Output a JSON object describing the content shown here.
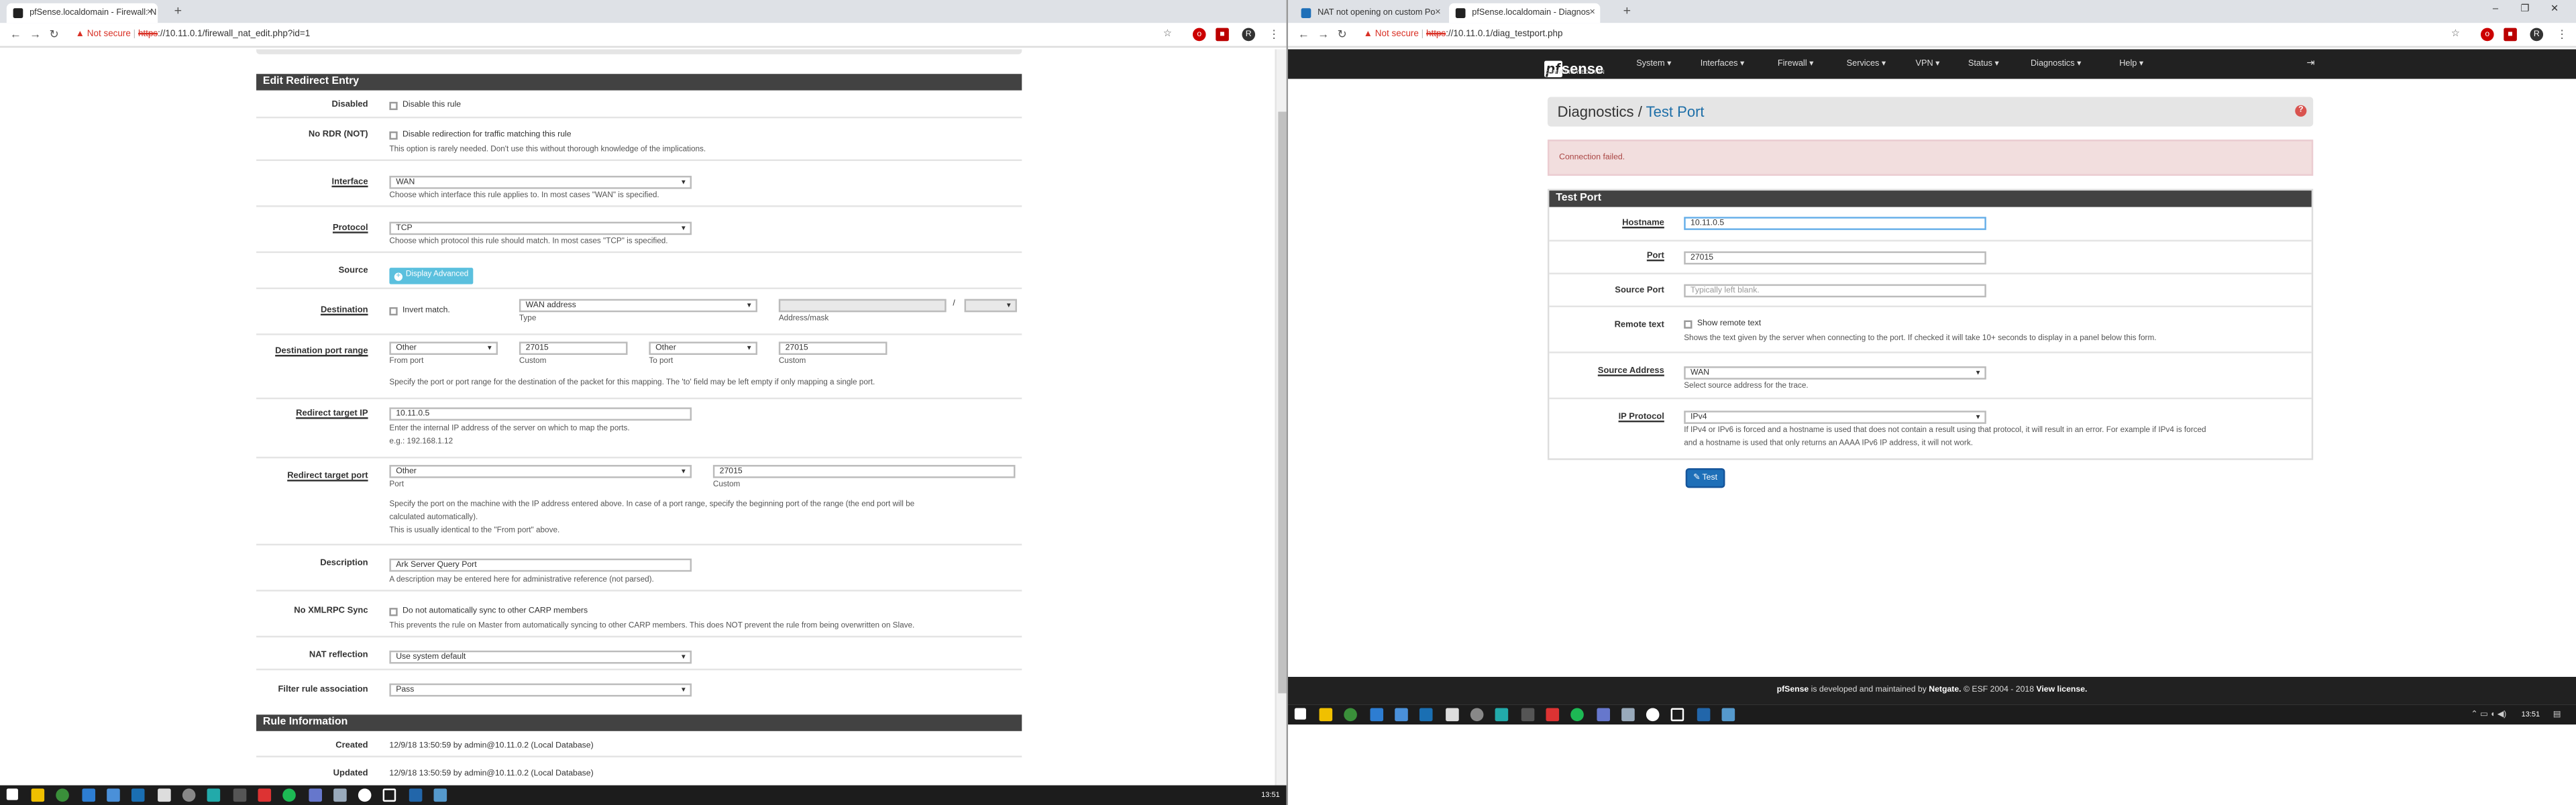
{
  "colors": {
    "pf_dark": "#212121",
    "panel_head": "#424242",
    "accent_blue": "#1e6fb8",
    "alert_bg": "#f2dede",
    "info_btn": "#5bc0de",
    "taskbar": "#1c1c1c"
  },
  "left": {
    "tabs": [
      {
        "title": "pfSense.localdomain - Firewall: N",
        "close": "×"
      }
    ],
    "new_tab": "+",
    "address": {
      "warning": "Not secure",
      "scheme": "https",
      "url_rest": "://10.11.0.1/firewall_nat_edit.php?id=1"
    },
    "panel_title": "Edit Redirect Entry",
    "disabled": {
      "label": "Disabled",
      "text": "Disable this rule"
    },
    "nordr": {
      "label": "No RDR (NOT)",
      "text": "Disable redirection for traffic matching this rule",
      "help": "This option is rarely needed. Don't use this without thorough knowledge of the implications."
    },
    "interface": {
      "label": "Interface",
      "value": "WAN",
      "help": "Choose which interface this rule applies to. In most cases \"WAN\" is specified."
    },
    "protocol": {
      "label": "Protocol",
      "value": "TCP",
      "help": "Choose which protocol this rule should match. In most cases \"TCP\" is specified."
    },
    "source": {
      "label": "Source",
      "button": "Display Advanced"
    },
    "destination": {
      "label": "Destination",
      "invert": "Invert match.",
      "type_value": "WAN address",
      "type_label": "Type",
      "addr_label": "Address/mask",
      "slash": "/"
    },
    "dport": {
      "label": "Destination port range",
      "from_sel": "Other",
      "from_val": "27015",
      "to_sel": "Other",
      "to_val": "27015",
      "from_label": "From port",
      "custom1": "Custom",
      "to_label": "To port",
      "custom2": "Custom",
      "help": "Specify the port or port range for the destination of the packet for this mapping. The 'to' field may be left empty if only mapping a single port."
    },
    "redirect_ip": {
      "label": "Redirect target IP",
      "value": "10.11.0.5",
      "help1": "Enter the internal IP address of the server on which to map the ports.",
      "help2": "e.g.: 192.168.1.12"
    },
    "redirect_port": {
      "label": "Redirect target port",
      "sel": "Other",
      "value": "27015",
      "port_label": "Port",
      "custom": "Custom",
      "help1": "Specify the port on the machine with the IP address entered above. In case of a port range, specify the beginning port of the range (the end port will be",
      "help2": "calculated automatically).",
      "help3": "This is usually identical to the \"From port\" above."
    },
    "description": {
      "label": "Description",
      "value": "Ark Server Query Port",
      "help": "A description may be entered here for administrative reference (not parsed)."
    },
    "noxmlrpc": {
      "label": "No XMLRPC Sync",
      "text": "Do not automatically sync to other CARP members",
      "help": "This prevents the rule on Master from automatically syncing to other CARP members. This does NOT prevent the rule from being overwritten on Slave."
    },
    "natrefl": {
      "label": "NAT reflection",
      "value": "Use system default"
    },
    "filterassoc": {
      "label": "Filter rule association",
      "value": "Pass"
    },
    "rule_info": {
      "title": "Rule Information",
      "created_label": "Created",
      "created": "12/9/18 13:50:59 by admin@10.11.0.2 (Local Database)",
      "updated_label": "Updated",
      "updated": "12/9/18 13:50:59 by admin@10.11.0.2 (Local Database)"
    },
    "clock": "13:51"
  },
  "right": {
    "tabs": [
      {
        "title": "NAT not opening on custom Po",
        "close": "×"
      },
      {
        "title": "pfSense.localdomain - Diagnos",
        "close": "×"
      }
    ],
    "new_tab": "+",
    "window_controls": [
      "–",
      "❐",
      "✕"
    ],
    "address": {
      "warning": "Not secure",
      "scheme": "https",
      "url_rest": "://10.11.0.1/diag_testport.php"
    },
    "logo": {
      "pf": "pf",
      "sense": "sense",
      "edition": "COMMUNITY EDITION"
    },
    "menu": [
      "System ▾",
      "Interfaces ▾",
      "Firewall ▾",
      "Services ▾",
      "VPN ▾",
      "Status ▾",
      "Diagnostics ▾",
      "Help ▾"
    ],
    "logout": "⇥",
    "breadcrumb": {
      "parent": "Diagnostics /",
      "current": "Test Port"
    },
    "help_icon": "?",
    "alert": "Connection failed.",
    "panel_title": "Test Port",
    "hostname": {
      "label": "Hostname",
      "value": "10.11.0.5"
    },
    "port": {
      "label": "Port",
      "value": "27015"
    },
    "source_port": {
      "label": "Source Port",
      "placeholder": "Typically left blank."
    },
    "remote_text": {
      "label": "Remote text",
      "text": "Show remote text",
      "help": "Shows the text given by the server when connecting to the port. If checked it will take 10+ seconds to display in a panel below this form."
    },
    "source_address": {
      "label": "Source Address",
      "value": "WAN",
      "help": "Select source address for the trace."
    },
    "ip_protocol": {
      "label": "IP Protocol",
      "value": "IPv4",
      "help1": "If IPv4 or IPv6 is forced and a hostname is used that does not contain a result using that protocol, it will result in an error. For example if IPv4 is forced",
      "help2": "and a hostname is used that only returns an AAAA IPv6 IP address, it will not work."
    },
    "test_button": "Test",
    "footer": {
      "brand": "pfSense",
      "mid": " is developed and maintained by ",
      "netgate": "Netgate.",
      "copy": " © ESF 2004 - 2018 ",
      "license": "View license."
    },
    "clock": "13:51"
  }
}
